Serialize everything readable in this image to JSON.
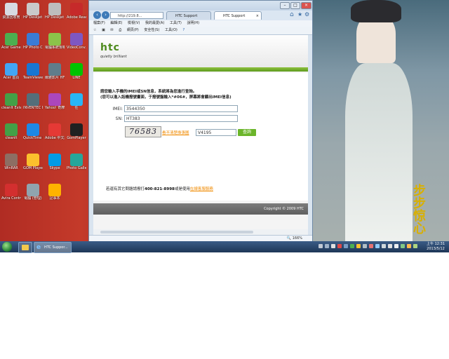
{
  "desktop": {
    "icons": [
      {
        "label": "資源回收筒",
        "color": "#d7dbe2"
      },
      {
        "label": "HP Deskjet 2000 J21...",
        "color": "#c9c9c9"
      },
      {
        "label": "HP Deskjet 2000 J21...",
        "color": "#bdbdbd"
      },
      {
        "label": "Adobe Reader X",
        "color": "#c62a2a"
      },
      {
        "label": "Acer Games",
        "color": "#4caf50"
      },
      {
        "label": "HP Photo Creations",
        "color": "#3a7bd5"
      },
      {
        "label": "電腦系統規格 檢查工具",
        "color": "#8bc34a"
      },
      {
        "label": "VideoConv...",
        "color": "#7e57c2"
      },
      {
        "label": "Acer 首頁",
        "color": "#42a5f5"
      },
      {
        "label": "TeamViewer 8",
        "color": "#1976d2"
      },
      {
        "label": "爾雅影片 HFCD格...",
        "color": "#607d8b"
      },
      {
        "label": "LINE",
        "color": "#00c300"
      },
      {
        "label": "cleanIt External",
        "color": "#43a047"
      },
      {
        "label": "INVENTEC ECOPAGE...",
        "color": "#546e7a"
      },
      {
        "label": "Yahoo! 奇摩 即時通",
        "color": "#ab47bc"
      },
      {
        "label": "任",
        "color": "#29b6f6"
      },
      {
        "label": "cleanIt",
        "color": "#43a047"
      },
      {
        "label": "QuickTime Player",
        "color": "#1e88e5"
      },
      {
        "label": "Adobe 中文版 -電腦",
        "color": "#e53935"
      },
      {
        "label": "GomPlayer",
        "color": "#212121"
      },
      {
        "label": "WinRAR",
        "color": "#8d6e63"
      },
      {
        "label": "GOM Player",
        "color": "#fbc02d"
      },
      {
        "label": "Skype",
        "color": "#039be5"
      },
      {
        "label": "Photo Gallery",
        "color": "#26a69a"
      },
      {
        "label": "Avira Control",
        "color": "#d32f2f"
      },
      {
        "label": "電腦 (管理)",
        "color": "#90a4ae"
      },
      {
        "label": "記事本",
        "color": "#ffb300"
      }
    ]
  },
  "browser": {
    "address": "http://219.8...",
    "tabs": [
      {
        "label": "HTC Support"
      },
      {
        "label": "HTC Support"
      }
    ],
    "menu": [
      "檔案(F)",
      "編輯(E)",
      "檢視(V)",
      "我的最愛(A)",
      "工具(T)",
      "說明(H)"
    ],
    "commands": [
      "網頁(P)",
      "安全性(S)",
      "工具(O)"
    ],
    "zoom": "166%"
  },
  "page": {
    "logo": "htc",
    "tagline": "quietly brilliant",
    "intro_line1": "請您輸入手機的IMEI或SN信息，系統將為您進行查詢。",
    "intro_line2": "(您可以進入話機撥號畫面，于撥號盤輸入*#06#，屏幕將會顯出IMEI信息)",
    "imei_label": "IMEI:",
    "imei_value": "3544350",
    "sn_label": "SN:",
    "sn_value": "HT383",
    "captcha_text": "76583",
    "refresh_link": "看不清楚換張圖",
    "captcha_input": "V4195",
    "query_button": "查詢",
    "support_prefix": "若還有其它問題請撥打",
    "support_phone": "400-821-8998",
    "support_mid": "或是使用",
    "support_link": "在線客服服務",
    "copyright": "Copyright © 2009 HTC"
  },
  "taskbar": {
    "ie_button_label": "HTC Suppor...",
    "time": "上午 12:31",
    "date": "2013/5/12"
  },
  "wallpaper_text": "步步惊心"
}
